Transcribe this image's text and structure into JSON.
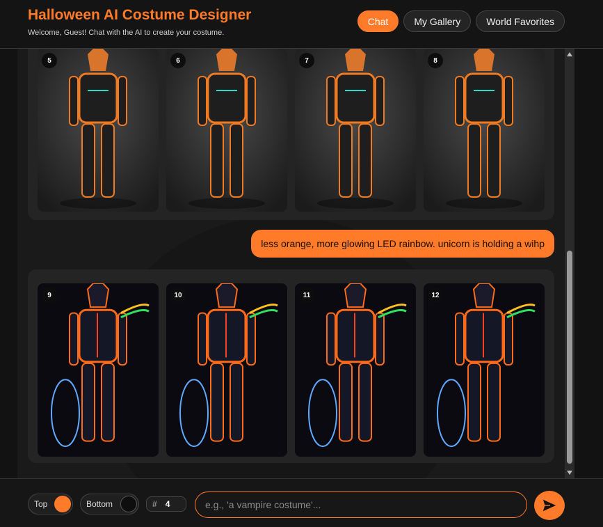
{
  "app": {
    "title": "Halloween AI Costume Designer",
    "subtitle": "Welcome, Guest! Chat with the AI to create your costume."
  },
  "nav": {
    "chat": "Chat",
    "gallery": "My Gallery",
    "favorites": "World Favorites",
    "active": "Chat"
  },
  "chat": {
    "batch_1": {
      "images": [
        {
          "number": "5",
          "style": "orange-armor"
        },
        {
          "number": "6",
          "style": "orange-armor"
        },
        {
          "number": "7",
          "style": "orange-armor"
        },
        {
          "number": "8",
          "style": "orange-armor"
        }
      ]
    },
    "user_message": "less orange, more glowing LED rainbow. unicorn is holding a wihp",
    "batch_2": {
      "images": [
        {
          "number": "9",
          "style": "led-rainbow"
        },
        {
          "number": "10",
          "style": "led-rainbow"
        },
        {
          "number": "11",
          "style": "led-rainbow"
        },
        {
          "number": "12",
          "style": "led-rainbow"
        }
      ]
    }
  },
  "footer": {
    "top_label": "Top",
    "top_on": true,
    "bottom_label": "Bottom",
    "bottom_on": false,
    "count_hash": "#",
    "count_value": "4",
    "prompt_placeholder": "e.g., 'a vampire costume'...",
    "prompt_value": ""
  },
  "colors": {
    "accent": "#ff7a29",
    "background": "#121212",
    "panel": "#242424"
  },
  "icons": {
    "send": "send-arrow-icon",
    "scroll_up": "scroll-up-arrow-icon",
    "scroll_down": "scroll-down-arrow-icon"
  }
}
